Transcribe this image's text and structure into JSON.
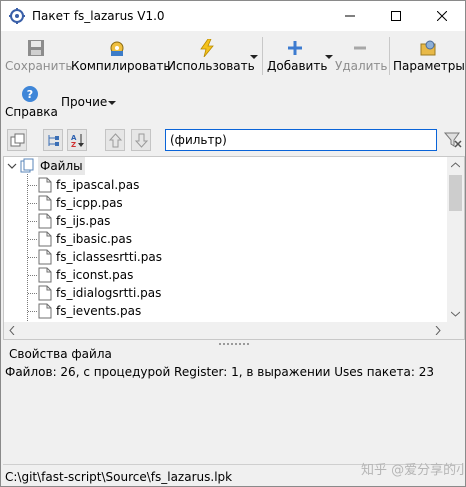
{
  "window": {
    "title": "Пакет fs_lazarus V1.0"
  },
  "toolbar": {
    "save": "Сохранить",
    "compile": "Компилировать",
    "use": "Использовать",
    "add": "Добавить",
    "remove": "Удалить",
    "options": "Параметры",
    "help": "Справка",
    "more": "Прочие"
  },
  "filter": {
    "value": "(фильтр)"
  },
  "tree": {
    "root": "Файлы",
    "files": [
      "fs_ipascal.pas",
      "fs_icpp.pas",
      "fs_ijs.pas",
      "fs_ibasic.pas",
      "fs_iclassesrtti.pas",
      "fs_iconst.pas",
      "fs_idialogsrtti.pas",
      "fs_ievents.pas"
    ]
  },
  "properties": {
    "title": "Свойства файла",
    "info": "Файлов: 26, с процедурой Register: 1, в выражении Uses пакета: 23"
  },
  "status": {
    "path": "C:\\git\\fast-script\\Source\\fs_lazarus.lpk"
  },
  "watermark": "知乎 @爱分享的小呢子"
}
